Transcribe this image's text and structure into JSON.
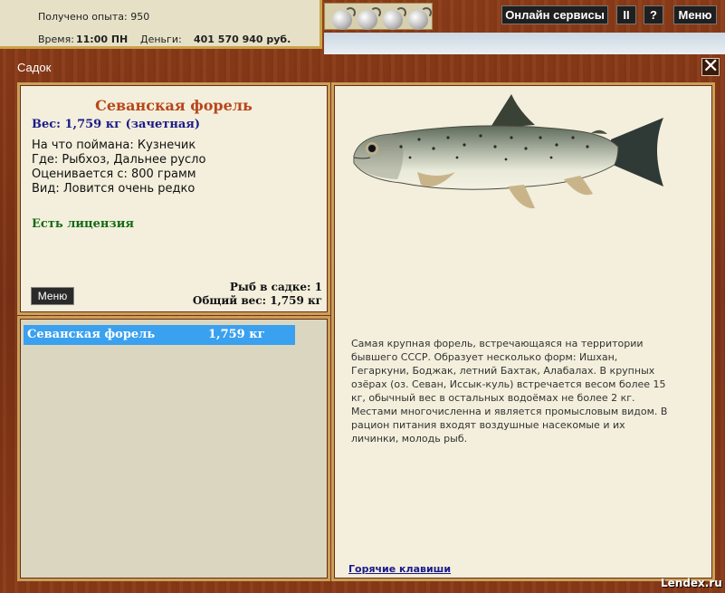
{
  "stats": {
    "exp_label": "Получено опыта:",
    "exp_value": "950",
    "time_label": "Время:",
    "time_value": "11:00 ПН",
    "money_label": "Деньги:",
    "money_value": "401 570 940 руб."
  },
  "topbar": {
    "online_services": "Онлайн сервисы",
    "pause": "II",
    "help": "?",
    "menu": "Меню",
    "bait_icons": [
      "bait-icon",
      "bait-icon",
      "bait-icon",
      "bait-icon"
    ]
  },
  "window": {
    "title": "Садок",
    "close": "✕"
  },
  "fish": {
    "name": "Севанская форель",
    "weight": "Вес: 1,759 кг (зачетная)",
    "caught_on": "На что поймана: Кузнечик",
    "where": "Где: Рыбхоз, Дальнее русло",
    "valued_from": "Оценивается с: 800 грамм",
    "kind": "Вид: Ловится очень редко",
    "license": "Есть лицензия"
  },
  "info_panel": {
    "menu_button": "Меню",
    "fish_count": "Рыб в садке: 1",
    "total_weight": "Общий вес: 1,759 кг"
  },
  "list": {
    "rows": [
      {
        "name": "Севанская форель",
        "weight": "1,759 кг"
      }
    ]
  },
  "description": {
    "text": "Самая крупная форель, встречающаяся на территории бывшего СССР. Образует несколько форм: Ишхан, Гегаркуни, Боджак, летний Бахтак, Алабалах. В крупных озёрах (оз. Севан, Иссык-куль) встречается весом более 15 кг, обычный вес в остальных водоёмах не более 2 кг. Местами многочисленна и является промысловым видом. В рацион питания входят воздушные насекомые и их личинки, молодь рыб.",
    "hotkeys_link": "Горячие клавиши"
  },
  "watermark": "Lendex.ru"
}
